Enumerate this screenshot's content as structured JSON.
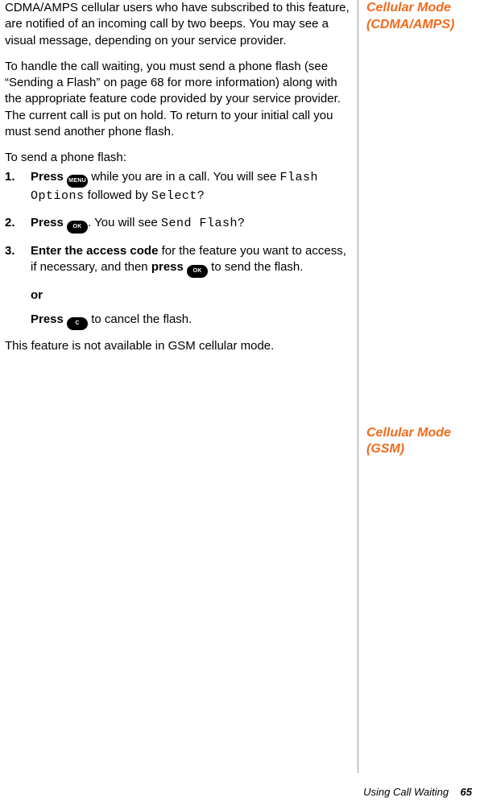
{
  "main": {
    "p1": "CDMA/AMPS cellular users who have subscribed to this feature, are notified of an incoming call by two beeps. You may see a visual message, depending on your service provider.",
    "p2": "To handle the call waiting, you must send a phone flash (see “Sending a Flash” on page 68 for more information) along with the appropriate feature code provided by your service provider. The current call is put on hold. To return to your initial call you must send another phone flash.",
    "p3": "To send a phone flash:",
    "steps": {
      "s1": {
        "num": "1.",
        "bold1": "Press ",
        "icon1": "MENU",
        "text1": " while you are in a call. You will see ",
        "pix1": "Flash Options",
        "text2": " followed by ",
        "pix2": "Select?"
      },
      "s2": {
        "num": "2.",
        "bold1": "Press ",
        "icon1": "OK",
        "text1": ". You will see ",
        "pix1": "Send Flash?"
      },
      "s3": {
        "num": "3.",
        "bold1": "Enter the access code",
        "text1": " for the feature you want to access, if necessary, and then ",
        "bold2": "press ",
        "icon1": "OK",
        "text2": " to send the flash."
      },
      "or": "or",
      "s3b": {
        "bold1": "Press ",
        "icon1": "C",
        "text1": " to cancel the flash."
      }
    },
    "p4": "This feature is not available in GSM cellular mode."
  },
  "side": {
    "note1": "Cellular Mode (CDMA/AMPS)",
    "note2": "Cellular Mode (GSM)"
  },
  "footer": {
    "text": "Using Call Waiting",
    "page": "65"
  }
}
